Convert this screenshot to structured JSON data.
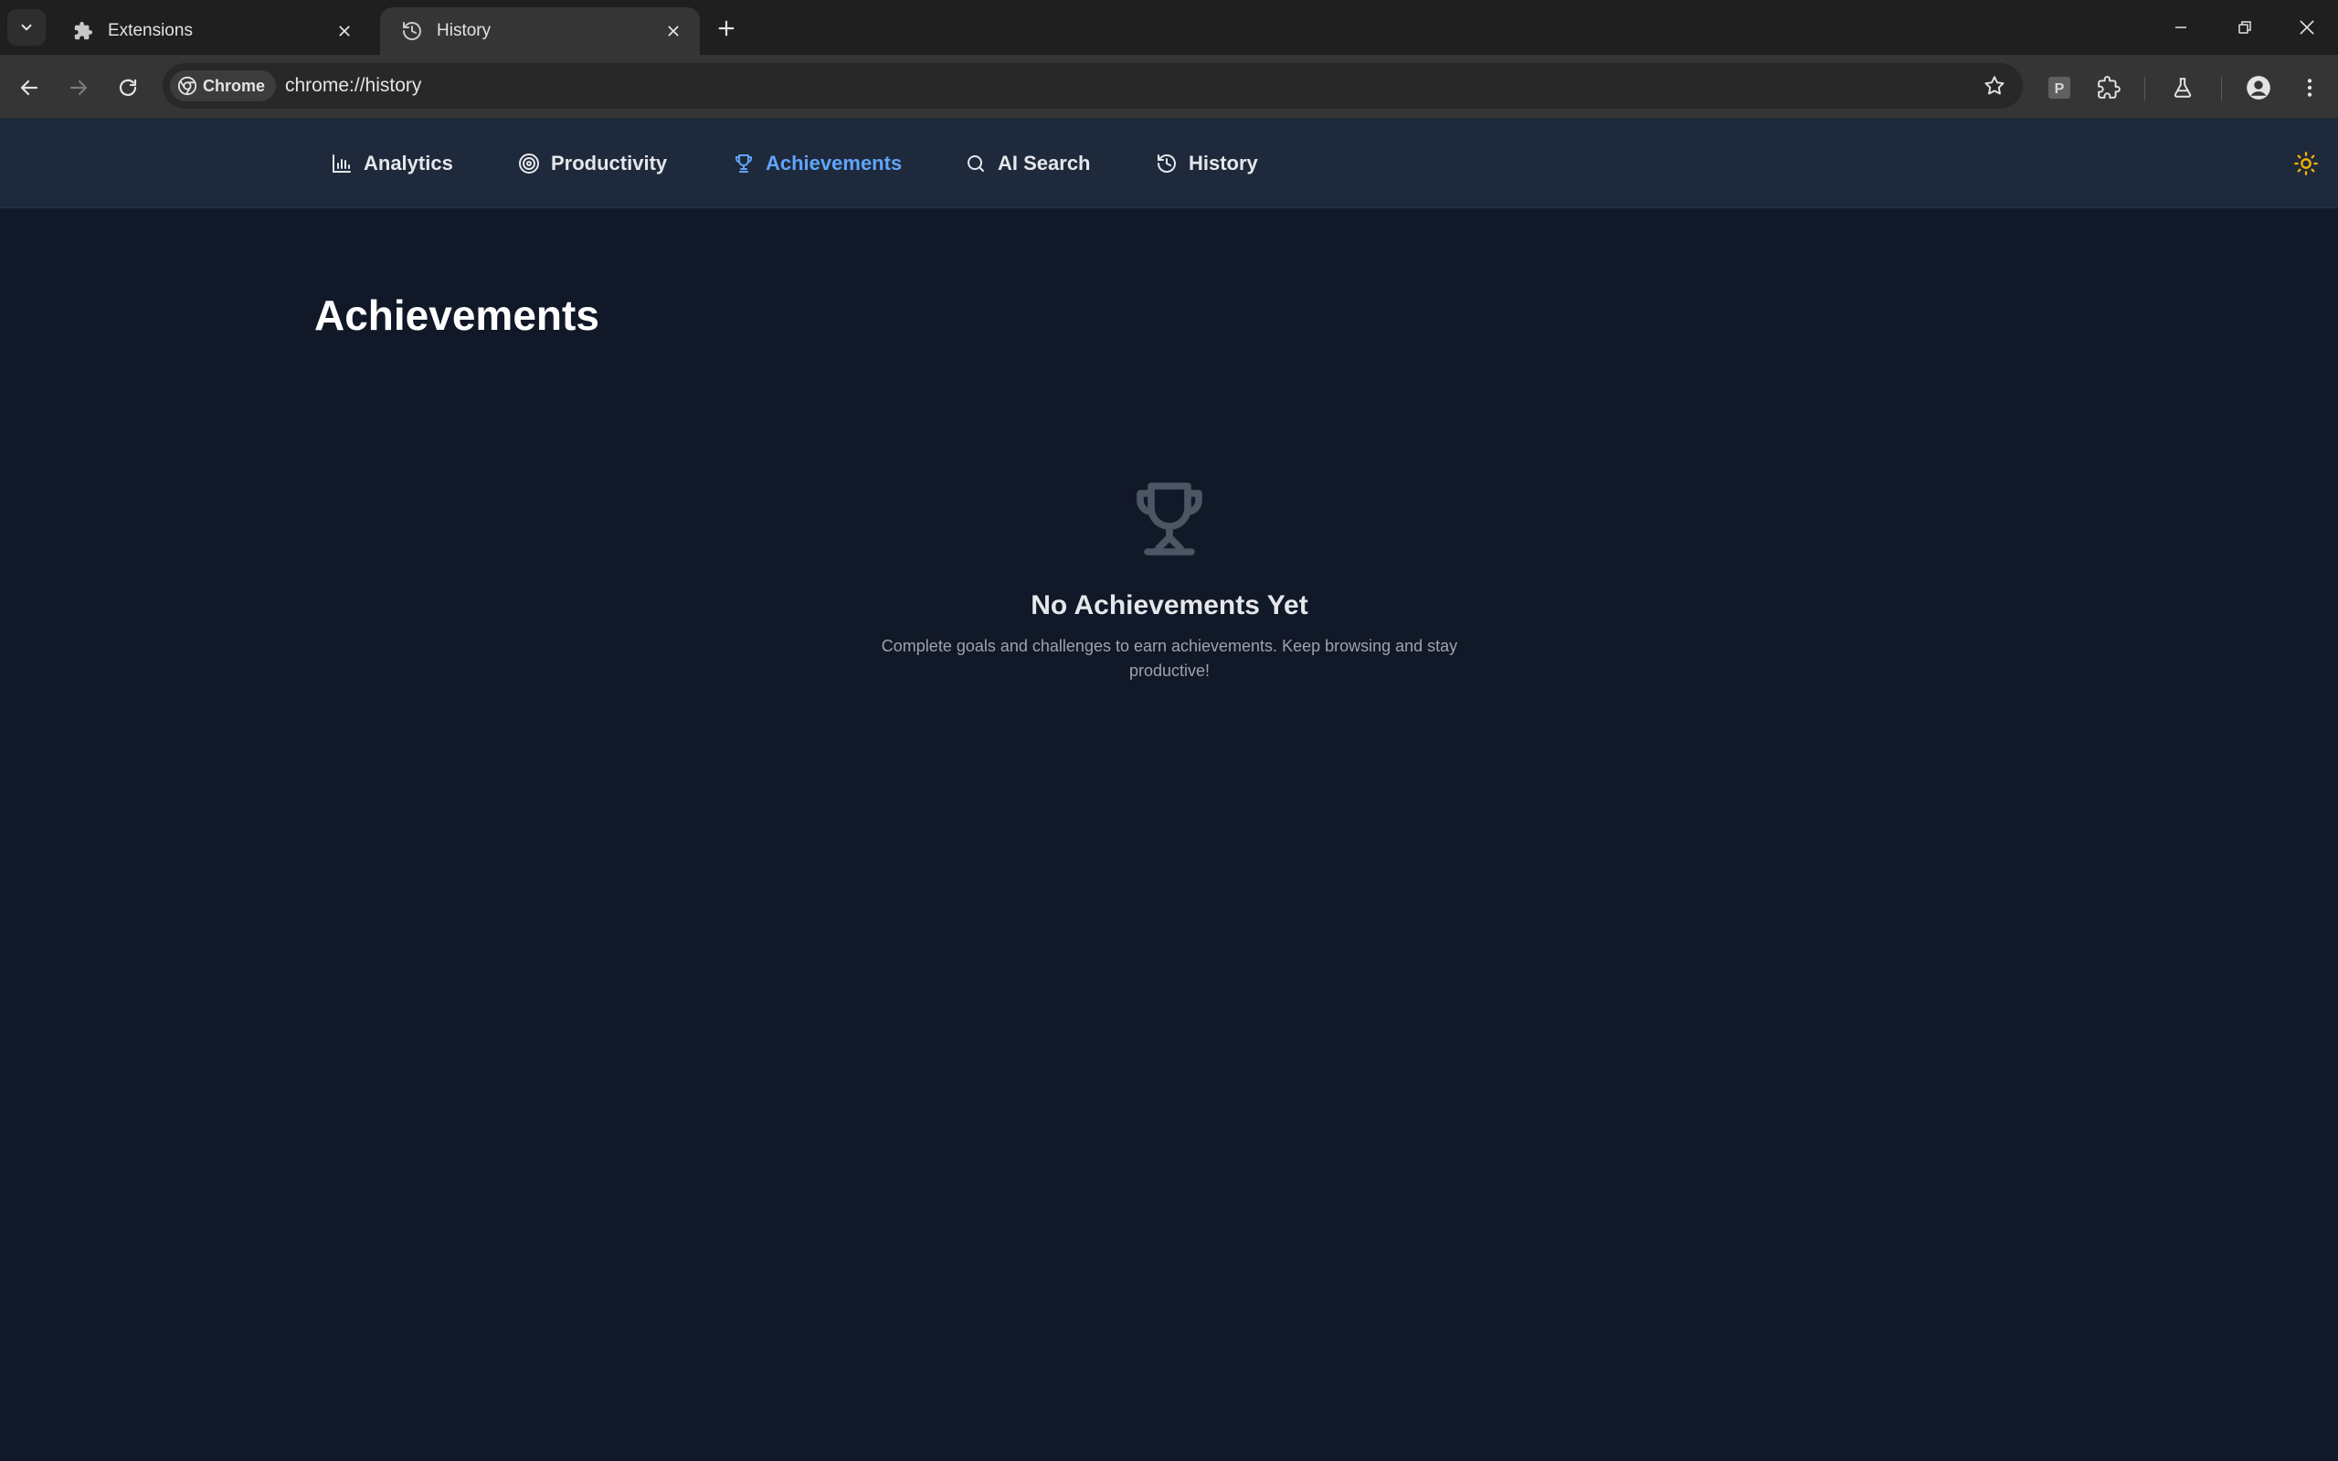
{
  "browser": {
    "tabs": [
      {
        "title": "Extensions",
        "icon": "puzzle-icon",
        "active": false
      },
      {
        "title": "History",
        "icon": "history-icon",
        "active": true
      }
    ],
    "omnibox": {
      "chip_label": "Chrome",
      "url": "chrome://history"
    },
    "extension_badge": "P"
  },
  "app": {
    "nav": [
      {
        "label": "Analytics",
        "icon": "bar-chart-icon"
      },
      {
        "label": "Productivity",
        "icon": "target-icon"
      },
      {
        "label": "Achievements",
        "icon": "trophy-icon",
        "active": true
      },
      {
        "label": "AI Search",
        "icon": "search-icon"
      },
      {
        "label": "History",
        "icon": "history-icon"
      }
    ],
    "theme_toggle_icon": "sun-icon",
    "page_title": "Achievements",
    "empty_state": {
      "icon": "trophy-icon",
      "title": "No Achievements Yet",
      "description": "Complete goals and challenges to earn achievements. Keep browsing and stay productive!"
    }
  },
  "colors": {
    "background": "#111827",
    "nav_background": "#1e293b",
    "accent": "#60a5fa",
    "sun": "#f5b400"
  }
}
